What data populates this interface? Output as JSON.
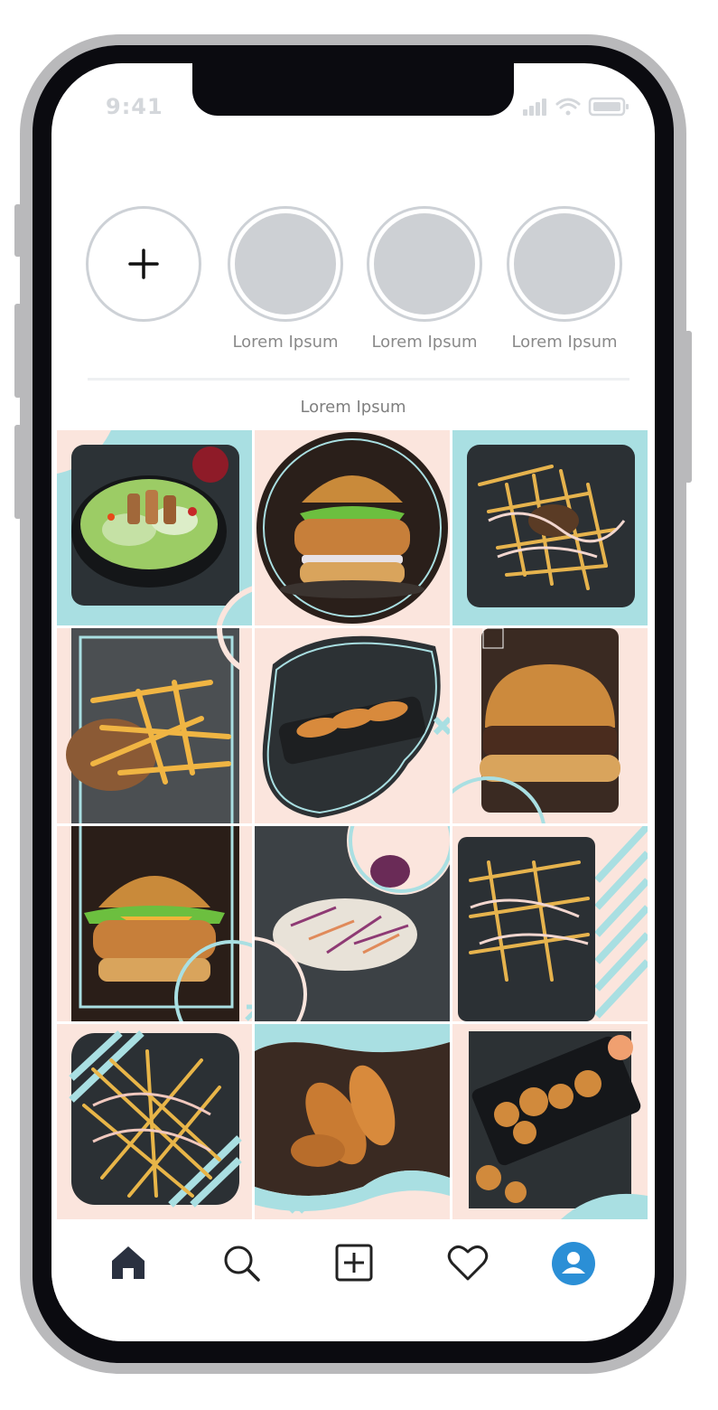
{
  "status_bar": {
    "time": "9:41"
  },
  "stories": [
    {
      "label": "",
      "type": "add"
    },
    {
      "label": "Lorem Ipsum",
      "type": "story"
    },
    {
      "label": "Lorem Ipsum",
      "type": "story"
    },
    {
      "label": "Lorem Ipsum",
      "type": "story"
    }
  ],
  "grid_title": "Lorem Ipsum",
  "posts": [
    {
      "name": "chicken-salad",
      "bg": "pastel-pink"
    },
    {
      "name": "fried-chicken-burger-circle",
      "bg": "pastel-pink"
    },
    {
      "name": "loaded-fries",
      "bg": "teal"
    },
    {
      "name": "seasoned-fries",
      "bg": "pastel-pink"
    },
    {
      "name": "fried-chicken-board",
      "bg": "pastel-pink"
    },
    {
      "name": "pulled-beef-burger",
      "bg": "pastel-pink"
    },
    {
      "name": "crispy-chicken-cheeseburger",
      "bg": "pastel-pink"
    },
    {
      "name": "coleslaw",
      "bg": "pastel-pink"
    },
    {
      "name": "loaded-fries-square",
      "bg": "pastel-pink"
    },
    {
      "name": "sauced-fries",
      "bg": "pastel-pink"
    },
    {
      "name": "chicken-tenders",
      "bg": "pastel-pink"
    },
    {
      "name": "chicken-bites-board",
      "bg": "pastel-pink"
    }
  ],
  "nav": [
    {
      "icon": "home-icon",
      "active": true
    },
    {
      "icon": "search-icon",
      "active": false
    },
    {
      "icon": "add-post-icon",
      "active": false
    },
    {
      "icon": "heart-icon",
      "active": false
    },
    {
      "icon": "profile-icon",
      "active": false
    }
  ],
  "colors": {
    "pastel_pink": "#fbe5dd",
    "teal": "#a9dfe2",
    "dark_slate": "#2c3236",
    "profile_blue": "#2b8fd6"
  }
}
